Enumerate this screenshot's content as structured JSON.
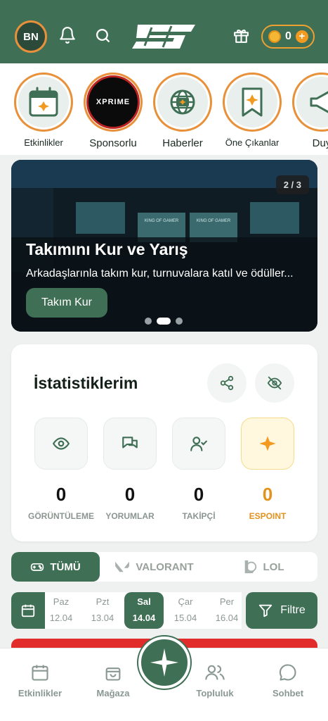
{
  "header": {
    "avatar_initials": "BN",
    "coin_count": "0",
    "icons": [
      "bell-icon",
      "search-icon",
      "gift-icon"
    ]
  },
  "stories": [
    {
      "label": "Etkinlikler",
      "icon": "calendar-icon"
    },
    {
      "label": "Sponsorlu",
      "icon": "xprime-logo"
    },
    {
      "label": "Haberler",
      "icon": "globe-icon"
    },
    {
      "label": "Öne Çıkanlar",
      "icon": "bookmark-icon"
    },
    {
      "label": "Duy",
      "icon": "megaphone-icon"
    }
  ],
  "banner": {
    "counter": "2 / 3",
    "title": "Takımını Kur ve Yarış",
    "subtitle": "Arkadaşlarınla takım kur, turnuvalara katıl ve ödüller...",
    "button": "Takım Kur",
    "screen_texts": [
      "KING OF GAMER",
      "KING OF GAMER"
    ],
    "sponsor_logo_text": "XPRIME",
    "active_slide": 2,
    "total_slides": 3
  },
  "stats": {
    "title": "İstatistiklerim",
    "items": [
      {
        "value": "0",
        "label": "GÖRÜNTÜLEME",
        "icon": "eye-icon"
      },
      {
        "value": "0",
        "label": "YORUMLAR",
        "icon": "chat-icon"
      },
      {
        "value": "0",
        "label": "TAKİPÇİ",
        "icon": "user-check-icon"
      },
      {
        "value": "0",
        "label": "ESPOINT",
        "icon": "star-icon"
      }
    ]
  },
  "game_tabs": [
    {
      "label": "TÜMÜ",
      "active": true,
      "icon": "gamepad-icon"
    },
    {
      "label": "VALORANT",
      "active": false,
      "icon": "valorant-icon"
    },
    {
      "label": "LOL",
      "active": false,
      "icon": "lol-icon"
    }
  ],
  "dates": [
    {
      "day": "Paz",
      "date": "12.04"
    },
    {
      "day": "Pzt",
      "date": "13.04"
    },
    {
      "day": "Sal",
      "date": "14.04",
      "active": true
    },
    {
      "day": "Çar",
      "date": "15.04"
    },
    {
      "day": "Per",
      "date": "16.04"
    }
  ],
  "filter_label": "Filtre",
  "bottom_nav": [
    {
      "label": "Etkinlikler",
      "icon": "calendar-icon"
    },
    {
      "label": "Mağaza",
      "icon": "shopping-bag-icon"
    },
    {
      "label": "Topluluk",
      "icon": "users-icon"
    },
    {
      "label": "Sohbet",
      "icon": "chat-bubble-icon"
    }
  ],
  "colors": {
    "primary": "#3f6f55",
    "accent": "#e8913a",
    "gold": "#e3921c",
    "danger": "#e22b2b"
  }
}
